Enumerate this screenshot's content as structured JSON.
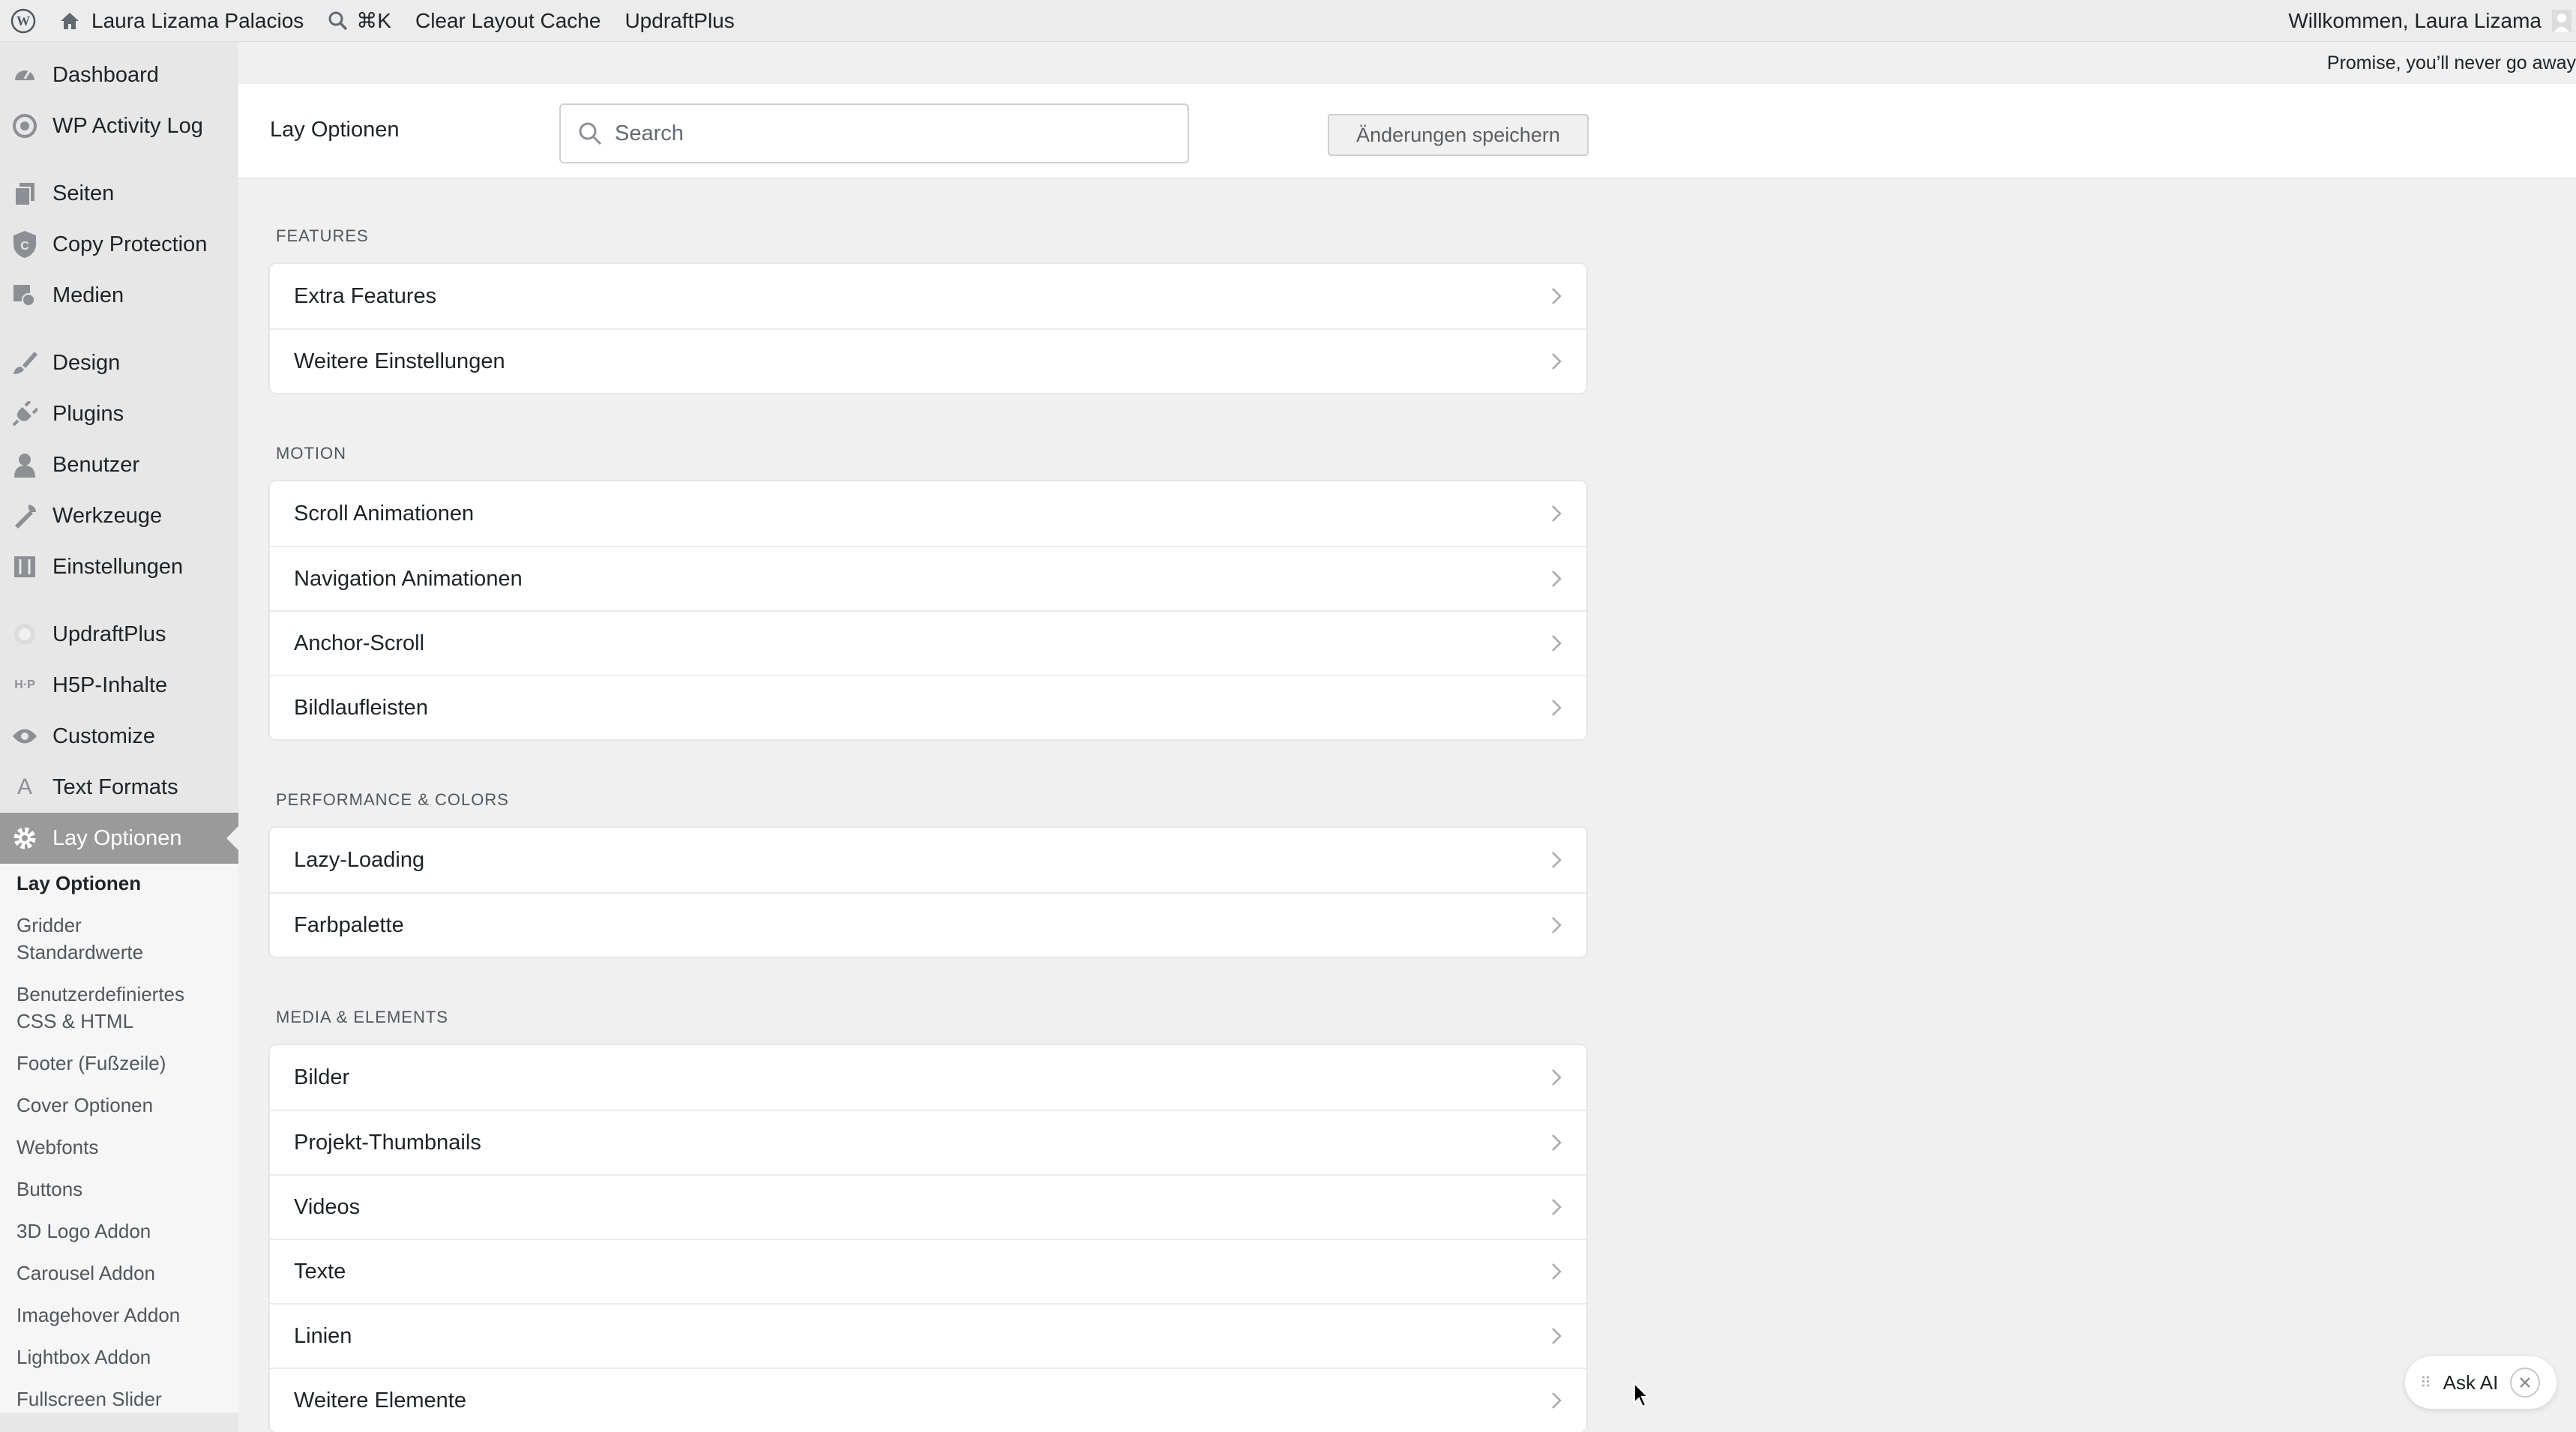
{
  "adminbar": {
    "site_name": "Laura Lizama Palacios",
    "search_shortcut": "⌘K",
    "clear_cache": "Clear Layout Cache",
    "updraft": "UpdraftPlus",
    "welcome": "Willkommen, Laura Lizama"
  },
  "sidebar": {
    "items": [
      {
        "label": "Dashboard",
        "icon": "dashboard-icon"
      },
      {
        "label": "WP Activity Log",
        "icon": "activity-log-icon"
      },
      {
        "label": "Seiten",
        "icon": "pages-icon"
      },
      {
        "label": "Copy Protection",
        "icon": "shield-icon"
      },
      {
        "label": "Medien",
        "icon": "media-icon"
      },
      {
        "label": "Design",
        "icon": "brush-icon"
      },
      {
        "label": "Plugins",
        "icon": "plug-icon"
      },
      {
        "label": "Benutzer",
        "icon": "user-icon"
      },
      {
        "label": "Werkzeuge",
        "icon": "wrench-icon"
      },
      {
        "label": "Einstellungen",
        "icon": "settings-sliders-icon"
      },
      {
        "label": "UpdraftPlus",
        "icon": "updraft-icon"
      },
      {
        "label": "H5P-Inhalte",
        "icon": "h5p-icon"
      },
      {
        "label": "Customize",
        "icon": "eye-icon"
      },
      {
        "label": "Text Formats",
        "icon": "text-format-icon"
      },
      {
        "label": "Lay Optionen",
        "icon": "gear-icon"
      }
    ],
    "submenu": [
      "Lay Optionen",
      "Gridder Standardwerte",
      "Benutzerdefiniertes CSS & HTML",
      "Footer (Fußzeile)",
      "Cover Optionen",
      "Webfonts",
      "Buttons",
      "3D Logo Addon",
      "Carousel Addon",
      "Imagehover Addon",
      "Lightbox Addon",
      "Fullscreen Slider"
    ]
  },
  "notice": "Promise, you’ll never go away",
  "header": {
    "title": "Lay Optionen",
    "search_placeholder": "Search",
    "save_label": "Änderungen speichern"
  },
  "sections": [
    {
      "label": "FEATURES",
      "items": [
        "Extra Features",
        "Weitere Einstellungen"
      ]
    },
    {
      "label": "MOTION",
      "items": [
        "Scroll Animationen",
        "Navigation Animationen",
        "Anchor-Scroll",
        "Bildlaufleisten"
      ]
    },
    {
      "label": "PERFORMANCE & COLORS",
      "items": [
        "Lazy-Loading",
        "Farbpalette"
      ]
    },
    {
      "label": "MEDIA & ELEMENTS",
      "items": [
        "Bilder",
        "Projekt-Thumbnails",
        "Videos",
        "Texte",
        "Linien",
        "Weitere Elemente"
      ]
    }
  ],
  "ask_ai": "Ask AI",
  "colors": {
    "active_menu": "#9a9a9a",
    "background": "#f0f0f1",
    "card": "#ffffff"
  }
}
